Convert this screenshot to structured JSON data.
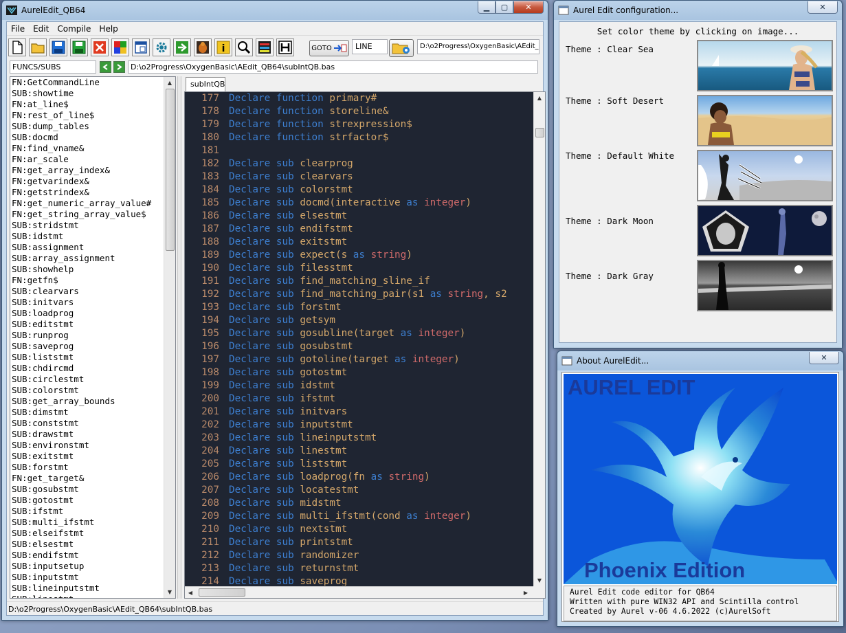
{
  "main": {
    "title": "AurelEdit_QB64",
    "menu": [
      "File",
      "Edit",
      "Compile",
      "Help"
    ],
    "toolbar": {
      "buttons": [
        "new-file-icon",
        "open-folder-icon",
        "save-icon",
        "save-as-icon",
        "close-icon",
        "color-palette-icon",
        "window-icon",
        "settings-gear-icon",
        "run-arrow-icon",
        "bug-icon",
        "info-icon",
        "search-icon",
        "list-icon",
        "binary-icon"
      ],
      "goto_label": "GOTO",
      "line_value": "LINE",
      "path_value": "D:\\o2Progress\\OxygenBasic\\AEdit_"
    },
    "funcs_value": "FUNCS/SUBS",
    "file_path": "D:\\o2Progress\\OxygenBasic\\AEdit_QB64\\subIntQB.bas",
    "tab_label": "subIntQB",
    "list": [
      "FN:GetCommandLine",
      "SUB:showtime",
      "FN:at_line$",
      "FN:rest_of_line$",
      "SUB:dump_tables",
      "SUB:docmd",
      "FN:find_vname&",
      "FN:ar_scale",
      "FN:get_array_index&",
      "FN:getvarindex&",
      "FN:getstrindex&",
      "FN:get_numeric_array_value#",
      "FN:get_string_array_value$",
      "SUB:stridstmt",
      "SUB:idstmt",
      "SUB:assignment",
      "SUB:array_assignment",
      "SUB:showhelp",
      "FN:getfn$",
      "SUB:clearvars",
      "SUB:initvars",
      "SUB:loadprog",
      "SUB:editstmt",
      "SUB:runprog",
      "SUB:saveprog",
      "SUB:liststmt",
      "SUB:chdircmd",
      "SUB:circlestmt",
      "SUB:colorstmt",
      "SUB:get_array_bounds",
      "SUB:dimstmt",
      "SUB:conststmt",
      "SUB:drawstmt",
      "SUB:environstmt",
      "SUB:exitstmt",
      "SUB:forstmt",
      "FN:get_target&",
      "SUB:gosubstmt",
      "SUB:gotostmt",
      "SUB:ifstmt",
      "SUB:multi_ifstmt",
      "SUB:elseifstmt",
      "SUB:elsestmt",
      "SUB:endifstmt",
      "SUB:inputsetup",
      "SUB:inputstmt",
      "SUB:lineinputstmt",
      "SUB:linestmt"
    ],
    "code": [
      {
        "n": "177",
        "kind": "function",
        "name": "primary#",
        "args": []
      },
      {
        "n": "178",
        "kind": "function",
        "name": "storeline&",
        "args": []
      },
      {
        "n": "179",
        "kind": "function",
        "name": "strexpression$",
        "args": []
      },
      {
        "n": "180",
        "kind": "function",
        "name": "strfactor$",
        "args": []
      },
      {
        "n": "181",
        "kind": "",
        "name": "",
        "args": []
      },
      {
        "n": "182",
        "kind": "sub",
        "name": "clearprog",
        "args": []
      },
      {
        "n": "183",
        "kind": "sub",
        "name": "clearvars",
        "args": []
      },
      {
        "n": "184",
        "kind": "sub",
        "name": "colorstmt",
        "args": []
      },
      {
        "n": "185",
        "kind": "sub",
        "name": "docmd(interactive",
        "args": [
          "as",
          "integer",
          ")"
        ]
      },
      {
        "n": "186",
        "kind": "sub",
        "name": "elsestmt",
        "args": []
      },
      {
        "n": "187",
        "kind": "sub",
        "name": "endifstmt",
        "args": []
      },
      {
        "n": "188",
        "kind": "sub",
        "name": "exitstmt",
        "args": []
      },
      {
        "n": "189",
        "kind": "sub",
        "name": "expect(s",
        "args": [
          "as",
          "string",
          ")"
        ]
      },
      {
        "n": "190",
        "kind": "sub",
        "name": "filesstmt",
        "args": []
      },
      {
        "n": "191",
        "kind": "sub",
        "name": "find_matching_sline_if",
        "args": []
      },
      {
        "n": "192",
        "kind": "sub",
        "name": "find_matching_pair(s1",
        "args": [
          "as",
          "string",
          ", s2"
        ]
      },
      {
        "n": "193",
        "kind": "sub",
        "name": "forstmt",
        "args": []
      },
      {
        "n": "194",
        "kind": "sub",
        "name": "getsym",
        "args": []
      },
      {
        "n": "195",
        "kind": "sub",
        "name": "gosubline(target",
        "args": [
          "as",
          "integer",
          ")"
        ]
      },
      {
        "n": "196",
        "kind": "sub",
        "name": "gosubstmt",
        "args": []
      },
      {
        "n": "197",
        "kind": "sub",
        "name": "gotoline(target",
        "args": [
          "as",
          "integer",
          ")"
        ]
      },
      {
        "n": "198",
        "kind": "sub",
        "name": "gotostmt",
        "args": []
      },
      {
        "n": "199",
        "kind": "sub",
        "name": "idstmt",
        "args": []
      },
      {
        "n": "200",
        "kind": "sub",
        "name": "ifstmt",
        "args": []
      },
      {
        "n": "201",
        "kind": "sub",
        "name": "initvars",
        "args": []
      },
      {
        "n": "202",
        "kind": "sub",
        "name": "inputstmt",
        "args": []
      },
      {
        "n": "203",
        "kind": "sub",
        "name": "lineinputstmt",
        "args": []
      },
      {
        "n": "204",
        "kind": "sub",
        "name": "linestmt",
        "args": []
      },
      {
        "n": "205",
        "kind": "sub",
        "name": "liststmt",
        "args": []
      },
      {
        "n": "206",
        "kind": "sub",
        "name": "loadprog(fn",
        "args": [
          "as",
          "string",
          ")"
        ]
      },
      {
        "n": "207",
        "kind": "sub",
        "name": "locatestmt",
        "args": []
      },
      {
        "n": "208",
        "kind": "sub",
        "name": "midstmt",
        "args": []
      },
      {
        "n": "209",
        "kind": "sub",
        "name": "multi_ifstmt(cond",
        "args": [
          "as",
          "integer",
          ")"
        ]
      },
      {
        "n": "210",
        "kind": "sub",
        "name": "nextstmt",
        "args": []
      },
      {
        "n": "211",
        "kind": "sub",
        "name": "printstmt",
        "args": []
      },
      {
        "n": "212",
        "kind": "sub",
        "name": "randomizer",
        "args": []
      },
      {
        "n": "213",
        "kind": "sub",
        "name": "returnstmt",
        "args": []
      },
      {
        "n": "214",
        "kind": "sub",
        "name": "saveprog",
        "args": []
      }
    ],
    "declare_word": "Declare",
    "status": "D:\\o2Progress\\OxygenBasic\\AEdit_QB64\\subIntQB.bas"
  },
  "config": {
    "title": "Aurel Edit configuration...",
    "heading": "Set color theme by clicking on image...",
    "themes": [
      {
        "label": "Theme : Clear Sea"
      },
      {
        "label": "Theme : Soft Desert"
      },
      {
        "label": "Theme : Default White"
      },
      {
        "label": "Theme : Dark Moon"
      },
      {
        "label": "Theme : Dark Gray"
      }
    ]
  },
  "about": {
    "title": "About AurelEdit...",
    "art_title": "AUREL EDIT",
    "art_subtitle": "Phoenix Edition",
    "lines": [
      "Aurel Edit code editor for QB64",
      "Written with pure WIN32 API and Scintilla control",
      "Created by Aurel v-06 4.6.2022 (c)AurelSoft"
    ]
  },
  "colors": {
    "editor_bg": "#1f2532",
    "keyword": "#3d7fd0",
    "identifier": "#d4a76a",
    "type": "#d06a6a",
    "line_number": "#b98a6a"
  }
}
